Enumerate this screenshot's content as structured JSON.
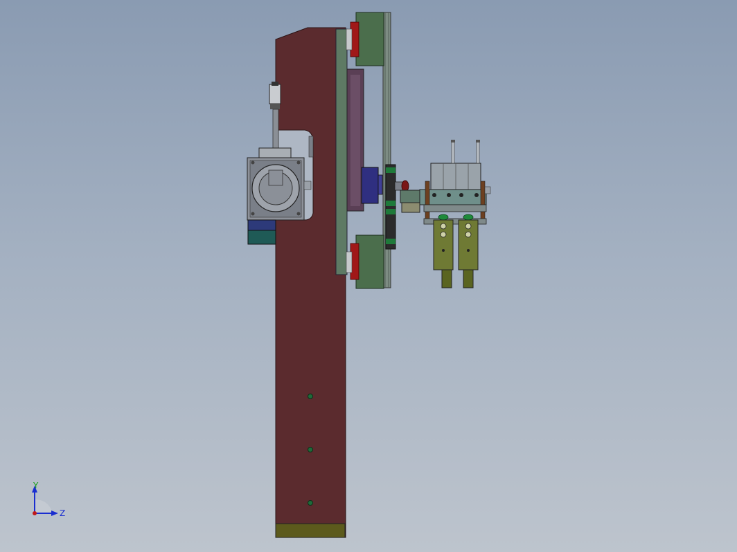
{
  "viewport": {
    "background_top": "#8a9bb2",
    "background_bottom": "#bdc4cd"
  },
  "model": {
    "parts": [
      "main-column",
      "motor-assembly",
      "linear-rail",
      "rail-carriages",
      "base-plate",
      "gripper-assembly"
    ],
    "colors": {
      "column": "#5b2b2e",
      "base_plate": "#5c5a1c",
      "rail": "#5e7a64",
      "carriage": "#4b6e4c",
      "motor": "#7a7f88",
      "gripper_body": "#6f7a34",
      "cylinder": "#9aa3aa",
      "accent_red": "#a01818"
    }
  },
  "triad": {
    "y_label": "Y",
    "z_label": "Z",
    "y_color": "#1aa01a",
    "z_color": "#1a2ed0",
    "origin_color": "#c01818"
  }
}
